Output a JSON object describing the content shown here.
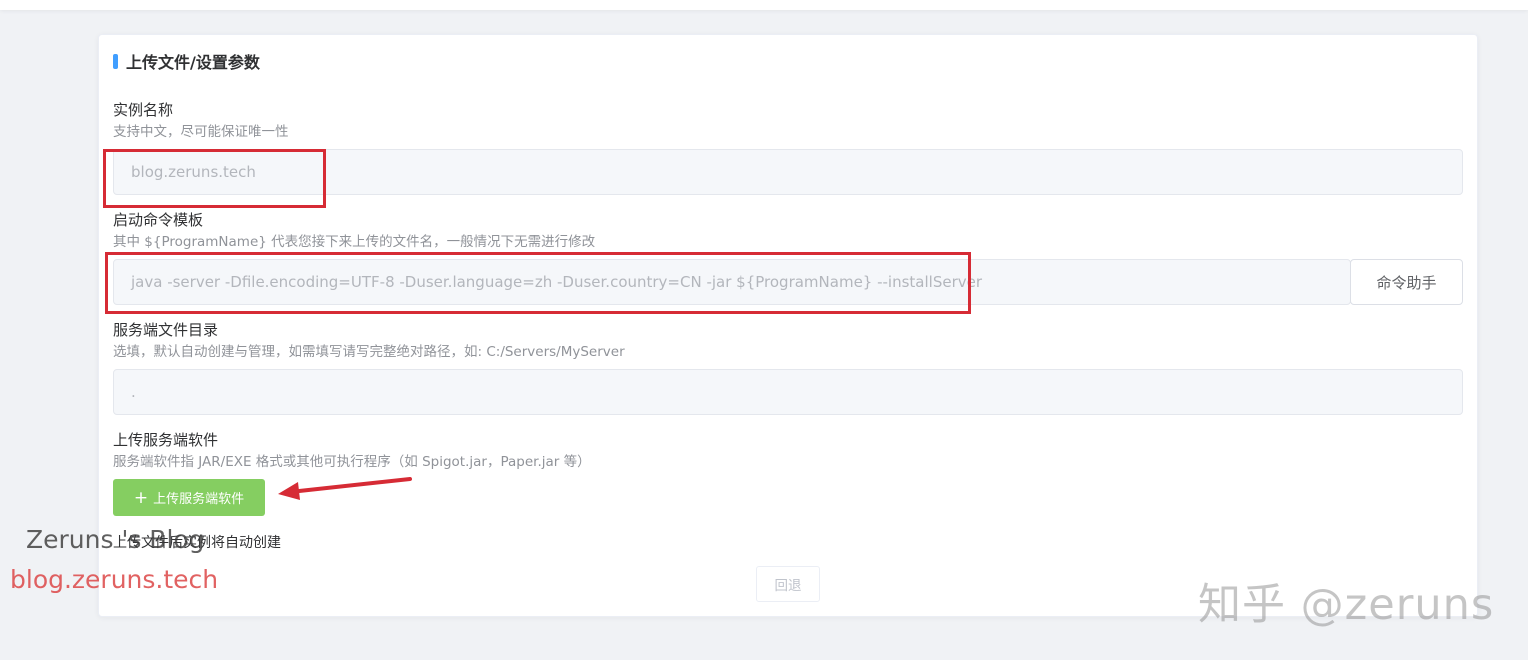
{
  "form": {
    "section_title": "上传文件/设置参数",
    "instance_name": {
      "label": "实例名称",
      "hint": "支持中文，尽可能保证唯一性",
      "value": "blog.zeruns.tech"
    },
    "start_command": {
      "label": "启动命令模板",
      "hint": "其中 ${ProgramName} 代表您接下来上传的文件名，一般情况下无需进行修改",
      "value": "java -server -Dfile.encoding=UTF-8 -Duser.language=zh -Duser.country=CN -jar ${ProgramName} --installServer",
      "helper_button": "命令助手"
    },
    "server_dir": {
      "label": "服务端文件目录",
      "hint": "选填，默认自动创建与管理，如需填写请写完整绝对路径，如: C:/Servers/MyServer",
      "value": "."
    },
    "upload": {
      "label": "上传服务端软件",
      "hint": "服务端软件指 JAR/EXE 格式或其他可执行程序（如 Spigot.jar，Paper.jar 等）",
      "plus_glyph": "+",
      "button": "上传服务端软件",
      "after_note": "上传文件后实例将自动创建"
    },
    "back_button": "回退"
  },
  "watermarks": {
    "brand": "Zeruns 's Blog",
    "url": "blog.zeruns.tech",
    "zhihu": "知乎 @zeruns"
  },
  "colors": {
    "accent": "#409eff",
    "success": "#85ce61",
    "highlight": "#d62b35"
  },
  "icons": {
    "upload_plus": "plus-icon",
    "annotation_arrow": "arrow-left-icon"
  }
}
